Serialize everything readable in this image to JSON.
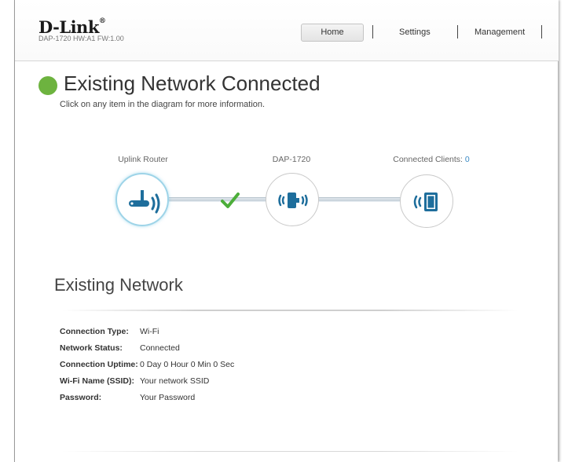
{
  "header": {
    "logo": "D-Link",
    "logo_reg": "®",
    "model_info": "DAP-1720 HW:A1 FW:1.00",
    "nav": {
      "home": "Home",
      "settings": "Settings",
      "management": "Management"
    }
  },
  "status": {
    "title": "Existing Network Connected",
    "subtitle": "Click on any item in the diagram for more information.",
    "color": "#6db33f"
  },
  "diagram": {
    "uplink_label": "Uplink Router",
    "device_label": "DAP-1720",
    "clients_label": "Connected Clients: ",
    "clients_count": "0",
    "link_status": "check-icon",
    "accent": "#3a8ac4"
  },
  "section": {
    "title": "Existing Network",
    "rows": [
      {
        "label": "Connection Type:",
        "value": "Wi-Fi"
      },
      {
        "label": "Network Status:",
        "value": "Connected"
      },
      {
        "label": "Connection Uptime:",
        "value": "0 Day 0 Hour 0 Min 0 Sec"
      },
      {
        "label": "Wi-Fi Name (SSID):",
        "value": "Your network SSID"
      },
      {
        "label": "Password:",
        "value": "Your Password"
      }
    ]
  }
}
